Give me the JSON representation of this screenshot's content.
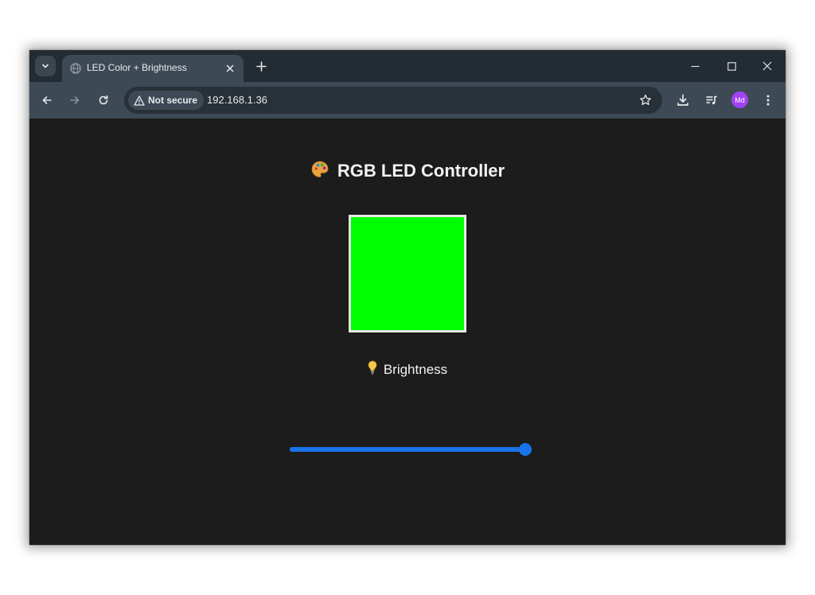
{
  "browser": {
    "tab": {
      "title": "LED Color + Brightness",
      "favicon_icon": "globe-icon"
    },
    "toolbar": {
      "security_label": "Not secure",
      "url": "192.168.1.36"
    },
    "profile": {
      "initials": "Md",
      "color": "#a142f4"
    }
  },
  "page": {
    "heading": "RGB LED Controller",
    "heading_icon": "palette-icon",
    "color_swatch": {
      "color": "#00ff00"
    },
    "brightness": {
      "label": "Brightness",
      "icon": "lightbulb-icon",
      "value_fraction": 1.0,
      "accent_color": "#1a73e8"
    }
  },
  "theme": {
    "page_background": "#1c1c1c",
    "chrome_frame": "#232b33",
    "chrome_toolbar": "#3d4a55"
  }
}
